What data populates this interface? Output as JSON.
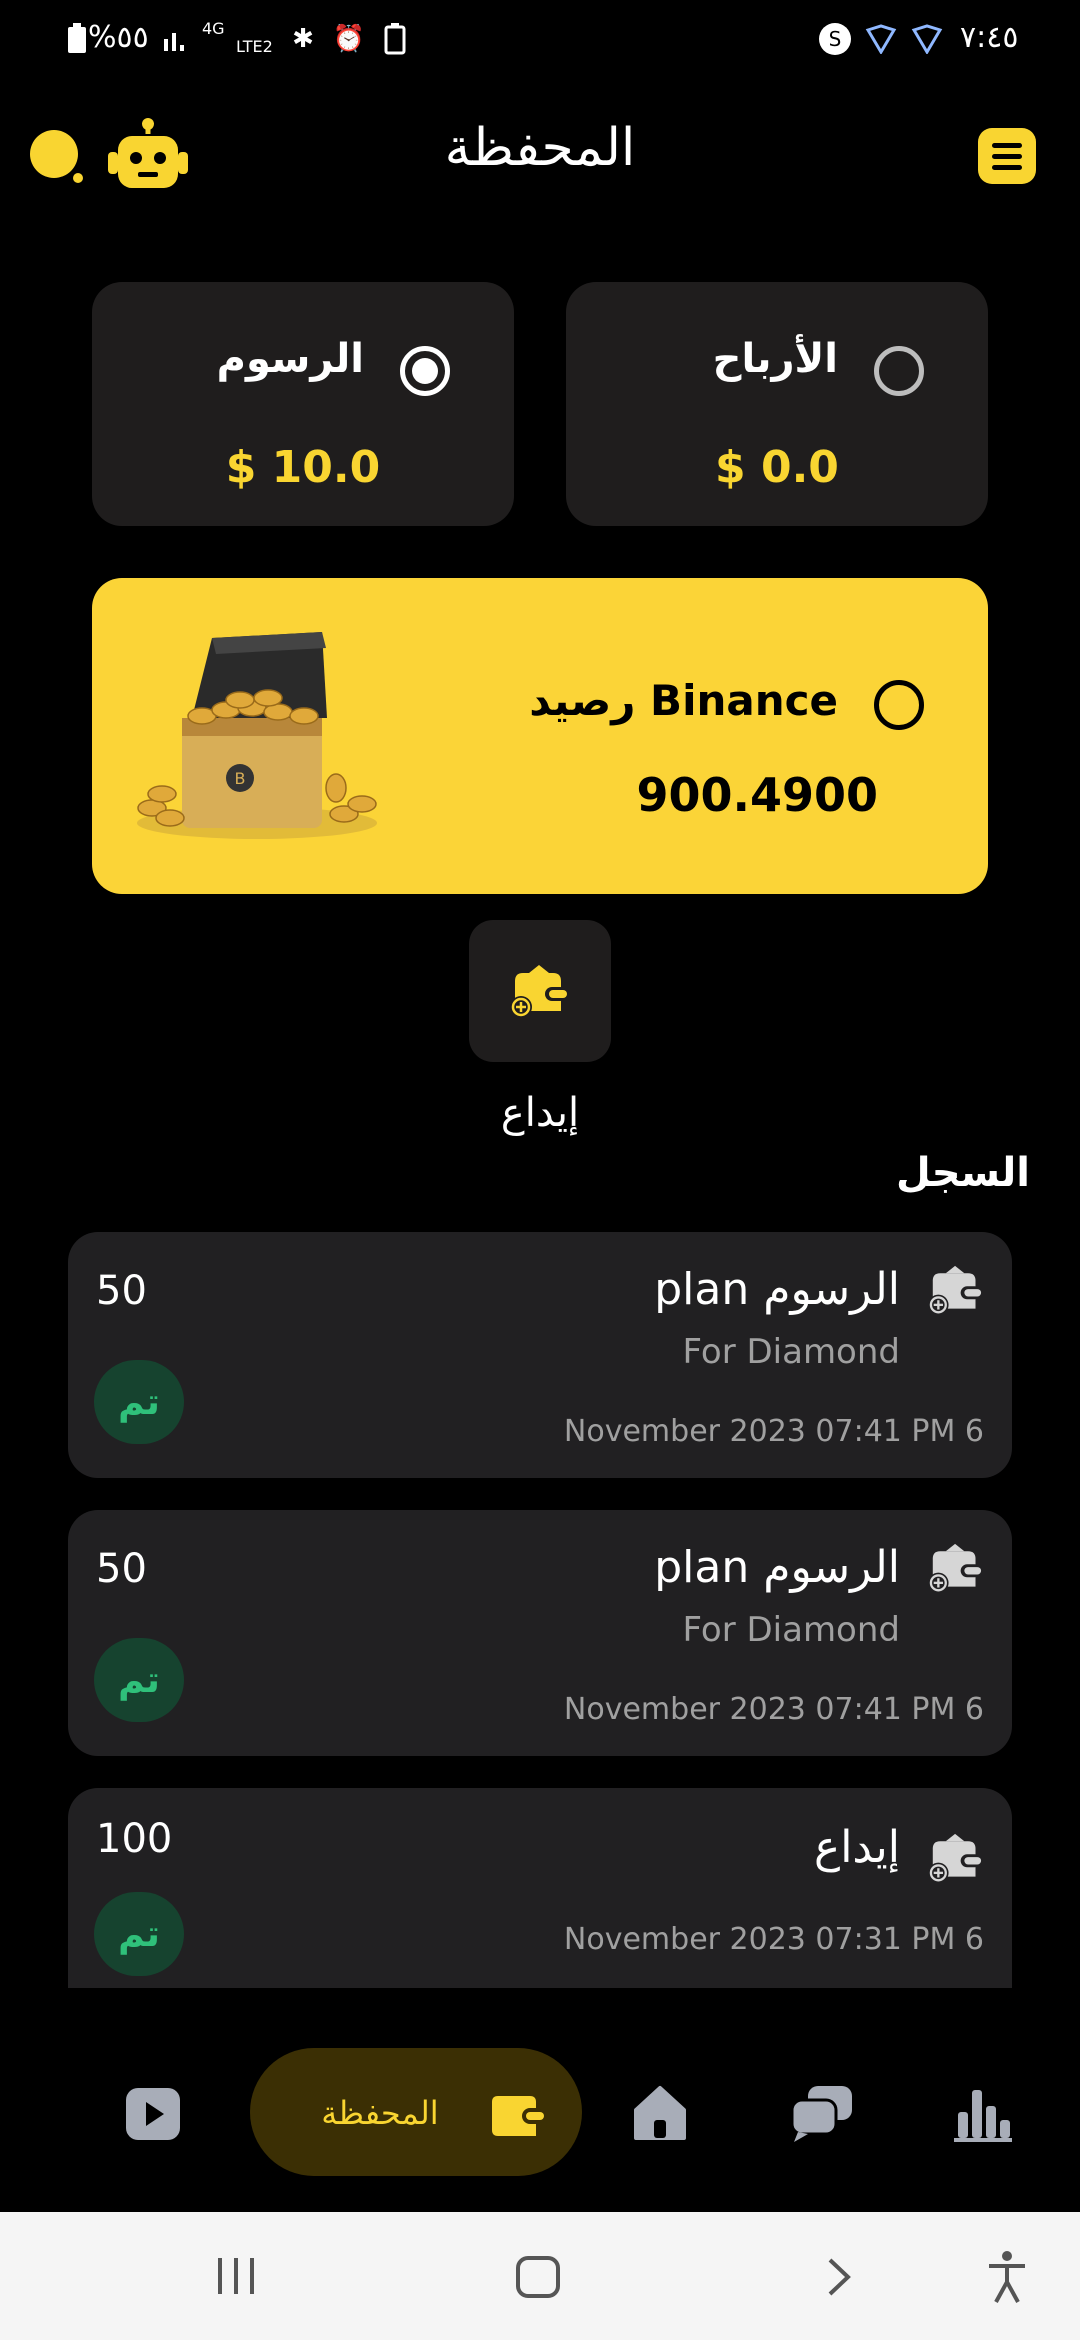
{
  "status_bar": {
    "time": "٧:٤٥",
    "battery": "%٥٥",
    "network": "4G",
    "network_sub": "LTE2"
  },
  "header": {
    "title": "المحفظة"
  },
  "balances": {
    "fees": {
      "label": "الرسوم",
      "value": "$ 10.0",
      "selected": true
    },
    "profits": {
      "label": "الأرباح",
      "value": "$ 0.0",
      "selected": false
    },
    "binance": {
      "label": "رصيد Binance",
      "value": "900.4900",
      "selected": false
    }
  },
  "deposit": {
    "label": "إيداع"
  },
  "history": {
    "title": "السجل",
    "items": [
      {
        "title": "plan الرسوم",
        "subtitle": "For Diamond",
        "date": "November 2023 07:41 PM 6",
        "amount": "50",
        "status": "تم"
      },
      {
        "title": "plan الرسوم",
        "subtitle": "For Diamond",
        "date": "November 2023 07:41 PM 6",
        "amount": "50",
        "status": "تم"
      },
      {
        "title": "إيداع",
        "subtitle": "",
        "date": "November 2023 07:31 PM 6",
        "amount": "100",
        "status": "تم"
      }
    ]
  },
  "bottom_nav": {
    "active_label": "المحفظة",
    "items": [
      "play-icon",
      "wallet-icon",
      "home-icon",
      "chat-icon",
      "chart-icon"
    ]
  },
  "colors": {
    "accent": "#f9d531",
    "card": "#1f1d1d",
    "success_bg": "#16432f",
    "success_text": "#2fc07a"
  }
}
